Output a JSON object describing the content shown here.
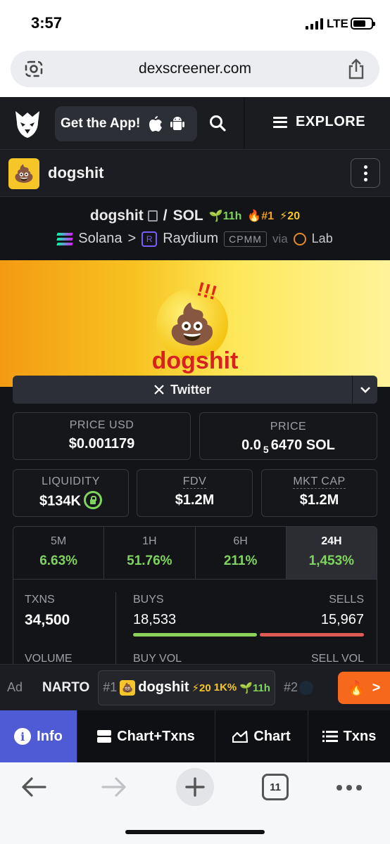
{
  "status_bar": {
    "time": "3:57",
    "network": "LTE"
  },
  "browser": {
    "url": "dexscreener.com",
    "tab_count": "11"
  },
  "header": {
    "get_app_label": "Get the App!",
    "explore_label": "EXPLORE"
  },
  "token": {
    "name": "dogshit",
    "avatar_emoji": "💩"
  },
  "pair": {
    "base": "dogshit",
    "slash": "/",
    "quote": "SOL",
    "age": "11h",
    "rank": "#1",
    "boosts": "20",
    "chain": "Solana",
    "dex": "Raydium",
    "pool_type": "CPMM",
    "via": "via",
    "launchpad": "Lab"
  },
  "banner": {
    "wordmark": "dogshit",
    "exclaim": "!!!"
  },
  "socials": {
    "twitter_label": "Twitter"
  },
  "stats": {
    "price_usd": {
      "label": "PRICE USD",
      "value": "$0.001179"
    },
    "price_native": {
      "label": "PRICE",
      "prefix": "0.0",
      "zeros": "5",
      "digits": "6470",
      "unit": "SOL"
    },
    "liquidity": {
      "label": "LIQUIDITY",
      "value": "$134K"
    },
    "fdv": {
      "label": "FDV",
      "value": "$1.2M"
    },
    "mkt_cap": {
      "label": "MKT CAP",
      "value": "$1.2M"
    }
  },
  "periods": [
    {
      "label": "5M",
      "value": "6.63%"
    },
    {
      "label": "1H",
      "value": "51.76%"
    },
    {
      "label": "6H",
      "value": "211%"
    },
    {
      "label": "24H",
      "value": "1,453%"
    }
  ],
  "selected_period": "24H",
  "txns": {
    "txns_label": "TXNS",
    "txns_value": "34,500",
    "buys_label": "BUYS",
    "buys_value": "18,533",
    "sells_label": "SELLS",
    "sells_value": "15,967",
    "buy_fraction": 0.537,
    "volume_label": "VOLUME",
    "buy_vol_label": "BUY VOL",
    "sell_vol_label": "SELL VOL"
  },
  "ticker": {
    "ad_label": "Ad",
    "ad_token": "NARTO",
    "item_rank": "#1",
    "item_name": "dogshit",
    "item_boosts": "20",
    "item_change": "1K%",
    "item_age": "11h",
    "next_rank": "#2"
  },
  "bottom_tabs": [
    {
      "label": "Info",
      "active": true
    },
    {
      "label": "Chart+Txns",
      "active": false
    },
    {
      "label": "Chart",
      "active": false
    },
    {
      "label": "Txns",
      "active": false
    }
  ],
  "colors": {
    "accent_blue": "#4f5bd5",
    "positive_green": "#7fd45e",
    "sell_red": "#e05a56",
    "background": "#131418",
    "ticker_fire": "#f6691c"
  },
  "icons": [
    "lens-icon",
    "share-icon",
    "eagle-logo-icon",
    "apple-icon",
    "android-icon",
    "search-icon",
    "menu-icon",
    "kebab-icon",
    "copy-icon",
    "seedling-icon",
    "flame-icon",
    "bolt-icon",
    "solana-icon",
    "raydium-icon",
    "lab-icon",
    "x-icon",
    "chevron-down-icon",
    "lock-icon",
    "info-icon",
    "chart-txns-icon",
    "chart-icon",
    "list-icon",
    "back-icon",
    "forward-icon",
    "plus-icon",
    "tabs-icon",
    "more-icon"
  ]
}
